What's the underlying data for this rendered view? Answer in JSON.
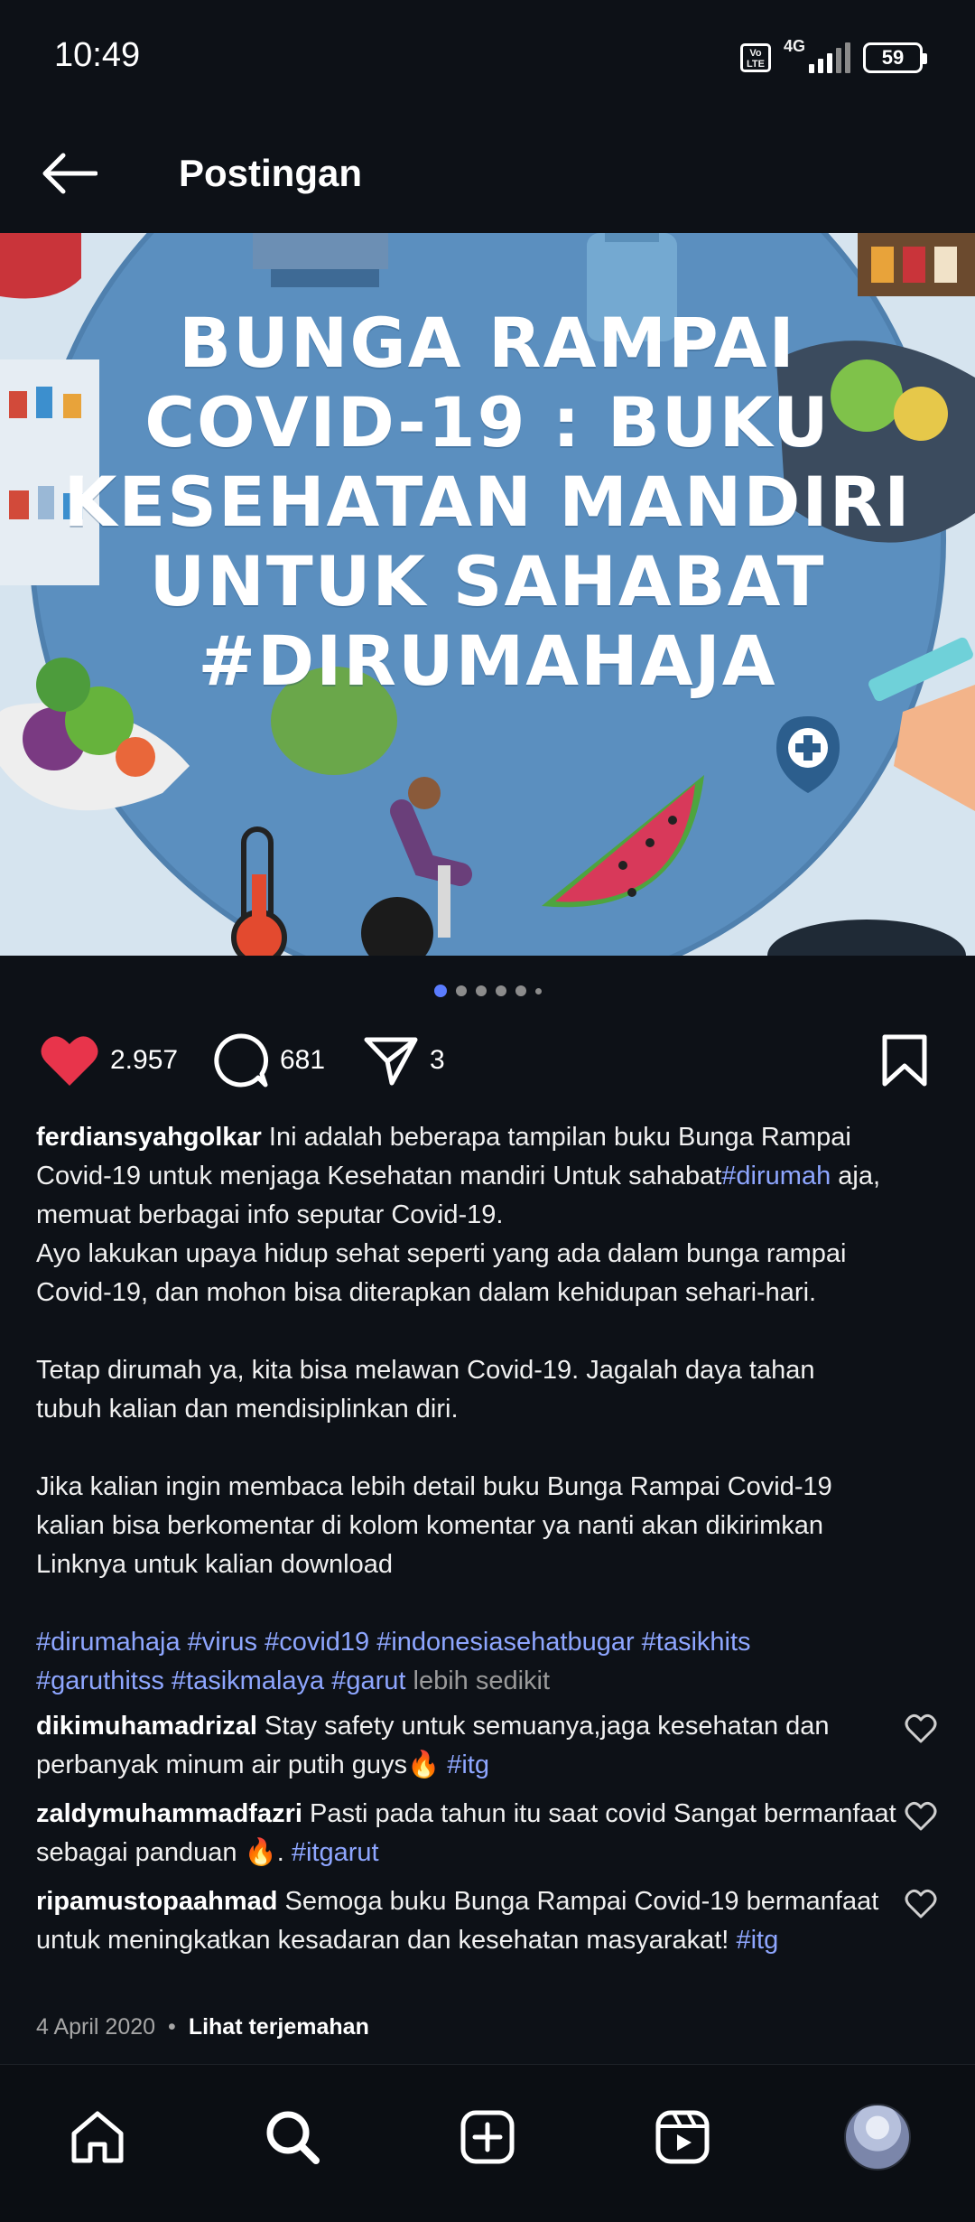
{
  "status_bar": {
    "time": "10:49",
    "volte": "Vo LTE",
    "network": "4G",
    "battery": "59"
  },
  "header": {
    "title": "Postingan",
    "back_icon": "back-arrow-icon"
  },
  "post_image": {
    "headline_lines": [
      "BUNGA RAMPAI",
      "COVID-19 : BUKU",
      "KESEHATAN MANDIRI",
      "UNTUK SAHABAT",
      "#DIRUMAHAJA"
    ],
    "carousel_total": 6,
    "carousel_current": 1
  },
  "actions": {
    "likes": "2.957",
    "comments": "681",
    "shares": "3",
    "like_color": "#e8344b"
  },
  "caption": {
    "username": "ferdiansyahgolkar",
    "line1_text": " Ini adalah beberapa tampilan buku Bunga Rampai",
    "line2_text": "Covid-19 untuk menjaga Kesehatan mandiri Untuk sahabat",
    "line2_tag": "#dirumah",
    "line2_end": " aja,",
    "line3": "memuat berbagai info seputar Covid-19.",
    "line4": "Ayo lakukan upaya hidup sehat seperti yang ada dalam bunga rampai",
    "line5": "Covid-19, dan mohon bisa diterapkan dalam kehidupan sehari-hari.",
    "line6": "Tetap dirumah ya, kita bisa melawan Covid-19. Jagalah daya tahan",
    "line7": "tubuh kalian dan mendisiplinkan diri.",
    "line8": "Jika kalian ingin membaca lebih detail buku Bunga Rampai Covid-19",
    "line9": "kalian bisa berkomentar di kolom komentar ya nanti akan dikirimkan",
    "line10": "Linknya untuk kalian download",
    "hashtags_line1": "#dirumahaja #virus #covid19 #indonesiasehatbugar #tasikhits",
    "hashtags_line2": "#garuthitss #tasikmalaya #garut",
    "less_label": " lebih sedikit"
  },
  "comments": [
    {
      "username": "dikimuhamadrizal",
      "text": " Stay safety untuk semuanya,jaga kesehatan dan perbanyak minum air putih guys🔥 ",
      "tag": "#itg"
    },
    {
      "username": "zaldymuhammadfazri",
      "text": " Pasti pada tahun itu saat covid Sangat bermanfaat sebagai panduan 🔥. ",
      "tag": "#itgarut"
    },
    {
      "username": "ripamustopaahmad",
      "text": " Semoga buku Bunga Rampai Covid-19 bermanfaat untuk meningkatkan kesadaran dan kesehatan masyarakat! ",
      "tag": "#itg"
    }
  ],
  "meta": {
    "date": "4 April 2020",
    "separator": "•",
    "translate": "Lihat terjemahan"
  },
  "bottom_nav": {
    "items": [
      "home-icon",
      "search-icon",
      "create-post-icon",
      "reels-icon",
      "profile-avatar"
    ]
  }
}
